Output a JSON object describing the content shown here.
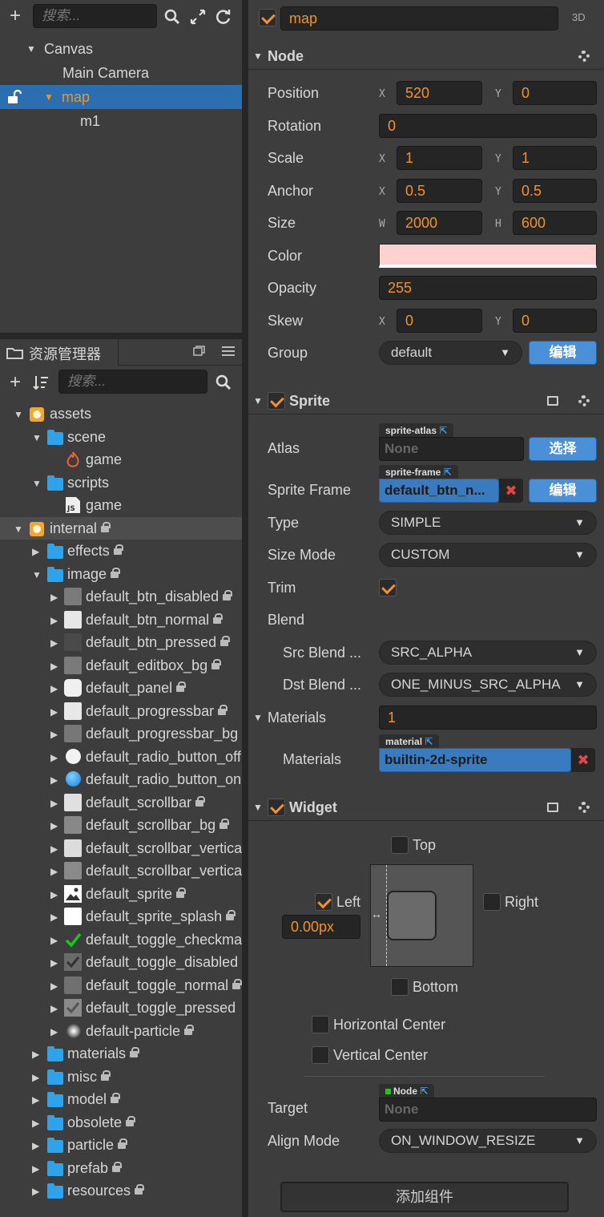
{
  "hierarchy": {
    "search_placeholder": "搜索...",
    "add_icon": "plus-icon",
    "tree": [
      {
        "label": "Canvas"
      },
      {
        "label": "Main Camera"
      },
      {
        "label": "map"
      },
      {
        "label": "m1"
      }
    ]
  },
  "assets": {
    "title": "资源管理器",
    "search_placeholder": "搜索...",
    "items": [
      {
        "label": "assets"
      },
      {
        "label": "scene"
      },
      {
        "label": "game"
      },
      {
        "label": "scripts"
      },
      {
        "label": "game"
      },
      {
        "label": "internal"
      },
      {
        "label": "effects"
      },
      {
        "label": "image"
      },
      {
        "label": "default_btn_disabled"
      },
      {
        "label": "default_btn_normal"
      },
      {
        "label": "default_btn_pressed"
      },
      {
        "label": "default_editbox_bg"
      },
      {
        "label": "default_panel"
      },
      {
        "label": "default_progressbar"
      },
      {
        "label": "default_progressbar_bg"
      },
      {
        "label": "default_radio_button_off"
      },
      {
        "label": "default_radio_button_on"
      },
      {
        "label": "default_scrollbar"
      },
      {
        "label": "default_scrollbar_bg"
      },
      {
        "label": "default_scrollbar_vertica"
      },
      {
        "label": "default_scrollbar_vertica"
      },
      {
        "label": "default_sprite"
      },
      {
        "label": "default_sprite_splash"
      },
      {
        "label": "default_toggle_checkma"
      },
      {
        "label": "default_toggle_disabled"
      },
      {
        "label": "default_toggle_normal"
      },
      {
        "label": "default_toggle_pressed"
      },
      {
        "label": "default-particle"
      },
      {
        "label": "materials"
      },
      {
        "label": "misc"
      },
      {
        "label": "model"
      },
      {
        "label": "obsolete"
      },
      {
        "label": "particle"
      },
      {
        "label": "prefab"
      },
      {
        "label": "resources"
      }
    ]
  },
  "inspector": {
    "node_name": "map",
    "mode_3d": "3D",
    "node_section": "Node",
    "position_label": "Position",
    "position_x": "520",
    "position_y": "0",
    "rotation_label": "Rotation",
    "rotation": "0",
    "scale_label": "Scale",
    "scale_x": "1",
    "scale_y": "1",
    "anchor_label": "Anchor",
    "anchor_x": "0.5",
    "anchor_y": "0.5",
    "size_label": "Size",
    "size_w": "2000",
    "size_h": "600",
    "color_label": "Color",
    "color_value": "#ffd0d0",
    "opacity_label": "Opacity",
    "opacity": "255",
    "skew_label": "Skew",
    "skew_x": "0",
    "skew_y": "0",
    "group_label": "Group",
    "group": "default",
    "group_edit": "编辑",
    "axis_x": "X",
    "axis_y": "Y",
    "axis_w": "W",
    "axis_h": "H",
    "sprite_section": "Sprite",
    "atlas_label": "Atlas",
    "atlas_tag": "sprite-atlas",
    "atlas_value": "None",
    "atlas_button": "选择",
    "frame_label": "Sprite Frame",
    "frame_tag": "sprite-frame",
    "frame_value": "default_btn_n...",
    "frame_button": "编辑",
    "type_label": "Type",
    "type": "SIMPLE",
    "sizemode_label": "Size Mode",
    "sizemode": "CUSTOM",
    "trim_label": "Trim",
    "blend_label": "Blend",
    "src_blend_label": "Src Blend ...",
    "src_blend": "SRC_ALPHA",
    "dst_blend_label": "Dst Blend ...",
    "dst_blend": "ONE_MINUS_SRC_ALPHA",
    "materials_label": "Materials",
    "materials_count": "1",
    "material_item_label": "Materials",
    "material_tag": "material",
    "material_value": "builtin-2d-sprite",
    "widget_section": "Widget",
    "top_label": "Top",
    "left_label": "Left",
    "right_label": "Right",
    "bottom_label": "Bottom",
    "left_value": "0.00px",
    "hcenter_label": "Horizontal Center",
    "vcenter_label": "Vertical Center",
    "target_label": "Target",
    "target_tag": "Node",
    "target_value": "None",
    "alignmode_label": "Align Mode",
    "alignmode": "ON_WINDOW_RESIZE",
    "add_component": "添加组件"
  },
  "colors": {
    "accent": "#f0922d",
    "selection": "#2c6fb0",
    "button_blue": "#4a90d9"
  }
}
